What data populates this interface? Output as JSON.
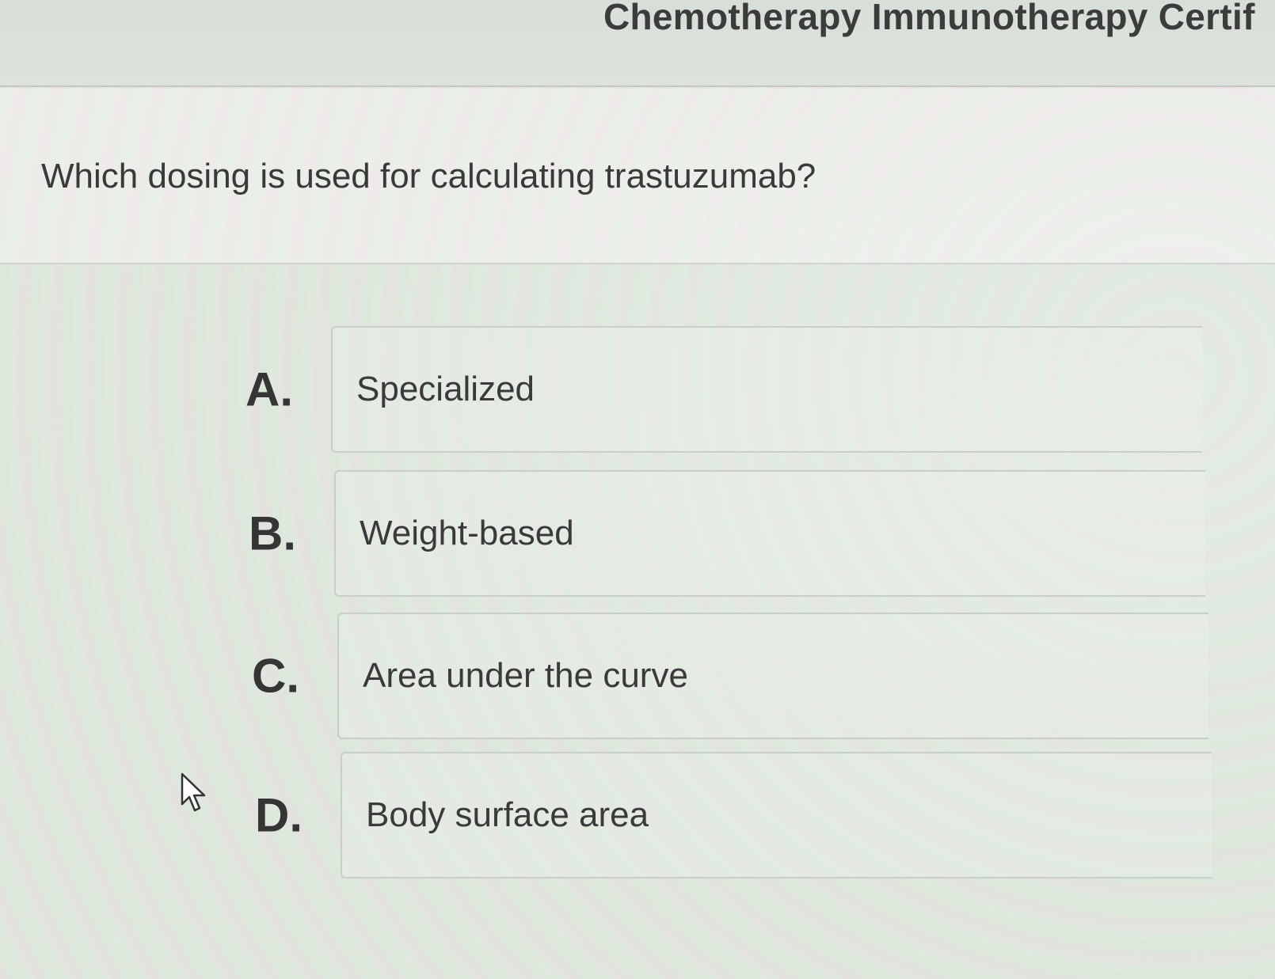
{
  "header": {
    "title": "Chemotherapy Immunotherapy Certif"
  },
  "question": {
    "text": "Which dosing is used for calculating trastuzumab?"
  },
  "options": [
    {
      "letter": "A.",
      "label": "Specialized"
    },
    {
      "letter": "B.",
      "label": "Weight-based"
    },
    {
      "letter": "C.",
      "label": "Area under the curve"
    },
    {
      "letter": "D.",
      "label": "Body surface area"
    }
  ],
  "icons": {
    "cursor": "mouse-pointer-icon"
  }
}
